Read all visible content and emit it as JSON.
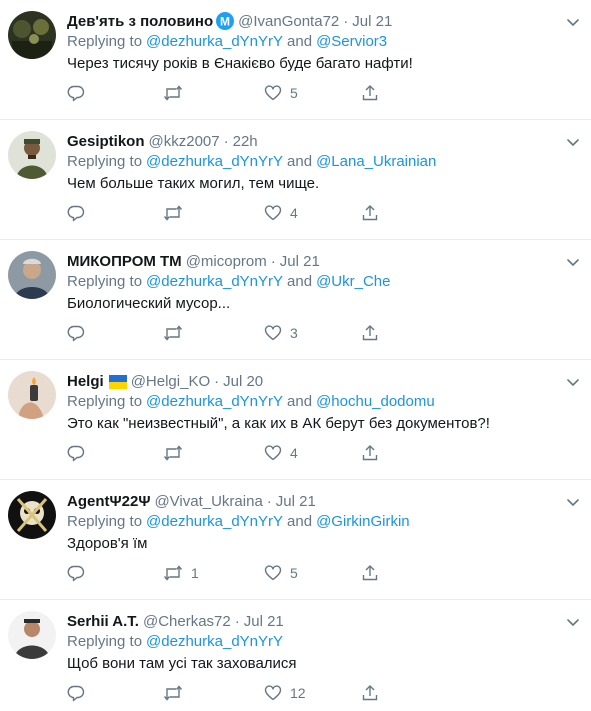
{
  "colors": {
    "link": "#1b95e0",
    "meta": "#657786",
    "text": "#14171a",
    "divider": "#e6ecf0"
  },
  "tweets": [
    {
      "name": "Дев'ять з половино",
      "badge": "M",
      "handle": "@IvanGonta72",
      "date": "Jul 21",
      "replying_prefix": "Replying to",
      "mentions": [
        "@dezhurka_dYnYrY",
        "@Servior3"
      ],
      "connector": "and",
      "text": "Через тисячу років в Єнакієво буде багато нафти!",
      "retweets": "",
      "likes": "5"
    },
    {
      "name": "Gesiptikon",
      "handle": "@kkz2007",
      "date": "22h",
      "replying_prefix": "Replying to",
      "mentions": [
        "@dezhurka_dYnYrY",
        "@Lana_Ukrainian"
      ],
      "connector": "and",
      "text": "Чем больше таких могил, тем чище.",
      "retweets": "",
      "likes": "4"
    },
    {
      "name": "МИКОПРОМ ТМ",
      "handle": "@micoprom",
      "date": "Jul 21",
      "replying_prefix": "Replying to",
      "mentions": [
        "@dezhurka_dYnYrY",
        "@Ukr_Che"
      ],
      "connector": "and",
      "text": "Биологический мусор...",
      "retweets": "",
      "likes": "3"
    },
    {
      "name": "Helgi",
      "flag": "ukraine-flag-icon",
      "handle": "@Helgi_KO",
      "date": "Jul 20",
      "replying_prefix": "Replying to",
      "mentions": [
        "@dezhurka_dYnYrY",
        "@hochu_dodomu"
      ],
      "connector": "and",
      "text": "Это как \"неизвестный\", а как их в АК берут без документов?!",
      "retweets": "",
      "likes": "4"
    },
    {
      "name": "AgentΨ22Ψ",
      "handle": "@Vivat_Ukraina",
      "date": "Jul 21",
      "replying_prefix": "Replying to",
      "mentions": [
        "@dezhurka_dYnYrY",
        "@GirkinGirkin"
      ],
      "connector": "and",
      "text": "Здоров'я їм",
      "retweets": "1",
      "likes": "5"
    },
    {
      "name": "Serhii A.T.",
      "handle": "@Cherkas72",
      "date": "Jul 21",
      "replying_prefix": "Replying to",
      "mentions": [
        "@dezhurka_dYnYrY"
      ],
      "connector": "",
      "text": "Щоб вони там усі так заховалися",
      "retweets": "",
      "likes": "12"
    }
  ],
  "icons": {
    "reply": "reply-icon",
    "retweet": "retweet-icon",
    "like": "heart-icon",
    "share": "share-icon",
    "more": "chevron-down-icon"
  }
}
